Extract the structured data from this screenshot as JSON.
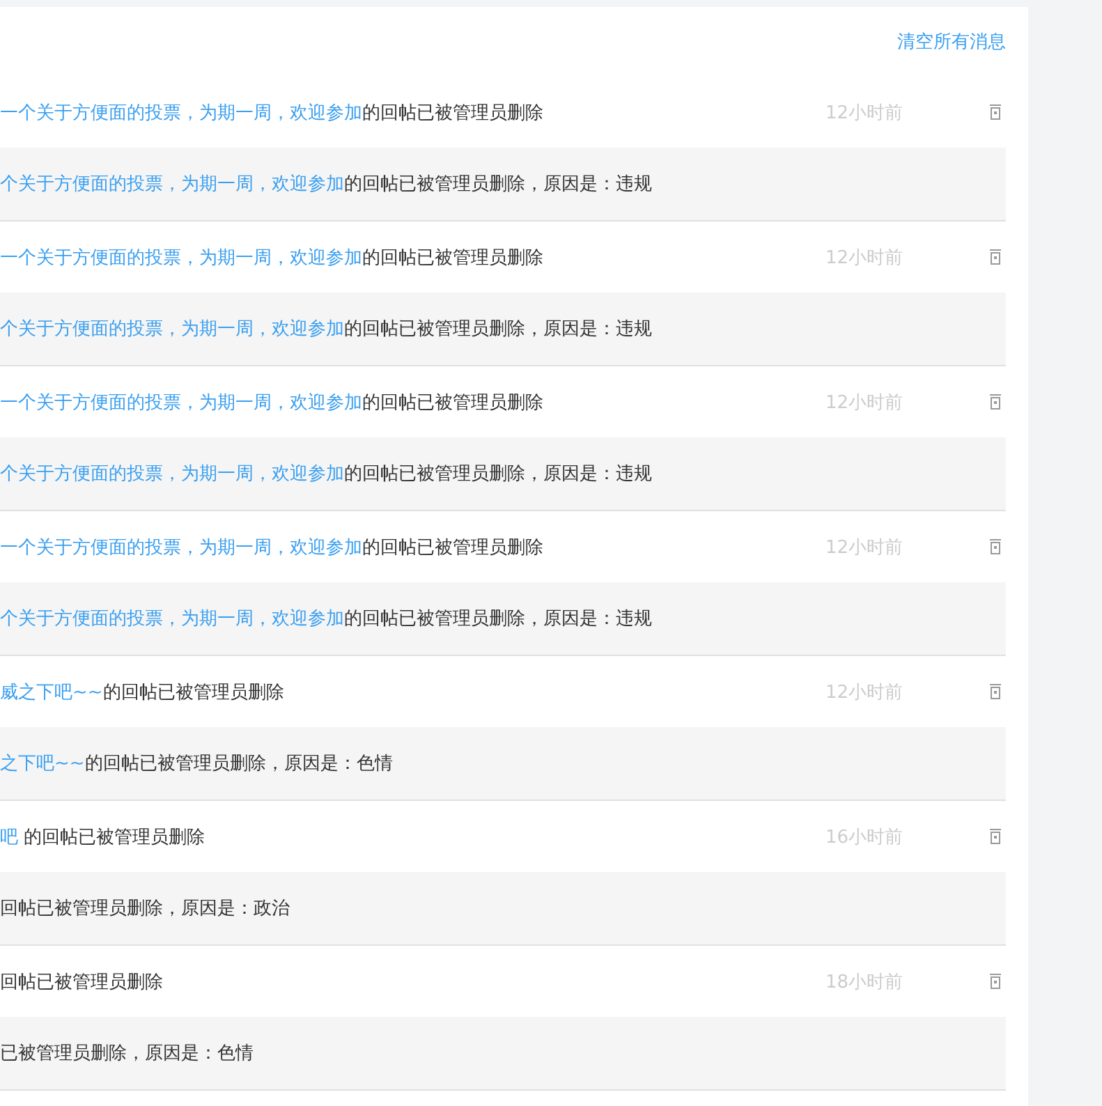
{
  "clear_all_link": "清空所有消息",
  "messages": [
    {
      "post_link": "一个关于方便面的投票，为期一周，欢迎参加",
      "notice": "的回帖已被管理员删除",
      "time": "12小时前",
      "detail_link": "个关于方便面的投票，为期一周，欢迎参加",
      "detail": "的回帖已被管理员删除，原因是：违规"
    },
    {
      "post_link": "一个关于方便面的投票，为期一周，欢迎参加",
      "notice": "的回帖已被管理员删除",
      "time": "12小时前",
      "detail_link": "个关于方便面的投票，为期一周，欢迎参加",
      "detail": "的回帖已被管理员删除，原因是：违规"
    },
    {
      "post_link": "一个关于方便面的投票，为期一周，欢迎参加",
      "notice": "的回帖已被管理员删除",
      "time": "12小时前",
      "detail_link": "个关于方便面的投票，为期一周，欢迎参加",
      "detail": "的回帖已被管理员删除，原因是：违规"
    },
    {
      "post_link": "一个关于方便面的投票，为期一周，欢迎参加",
      "notice": "的回帖已被管理员删除",
      "time": "12小时前",
      "detail_link": "个关于方便面的投票，为期一周，欢迎参加",
      "detail": "的回帖已被管理员删除，原因是：违规"
    },
    {
      "post_link": "威之下吧~~",
      "notice": "的回帖已被管理员删除",
      "time": "12小时前",
      "detail_link": "之下吧~~",
      "detail": "的回帖已被管理员删除，原因是：色情"
    },
    {
      "post_link": "吧",
      "notice": " 的回帖已被管理员删除",
      "time": "16小时前",
      "detail": "回帖已被管理员删除，原因是：政治"
    },
    {
      "notice": "回帖已被管理员删除",
      "time": "18小时前",
      "detail": "已被管理员删除，原因是：色情"
    }
  ]
}
